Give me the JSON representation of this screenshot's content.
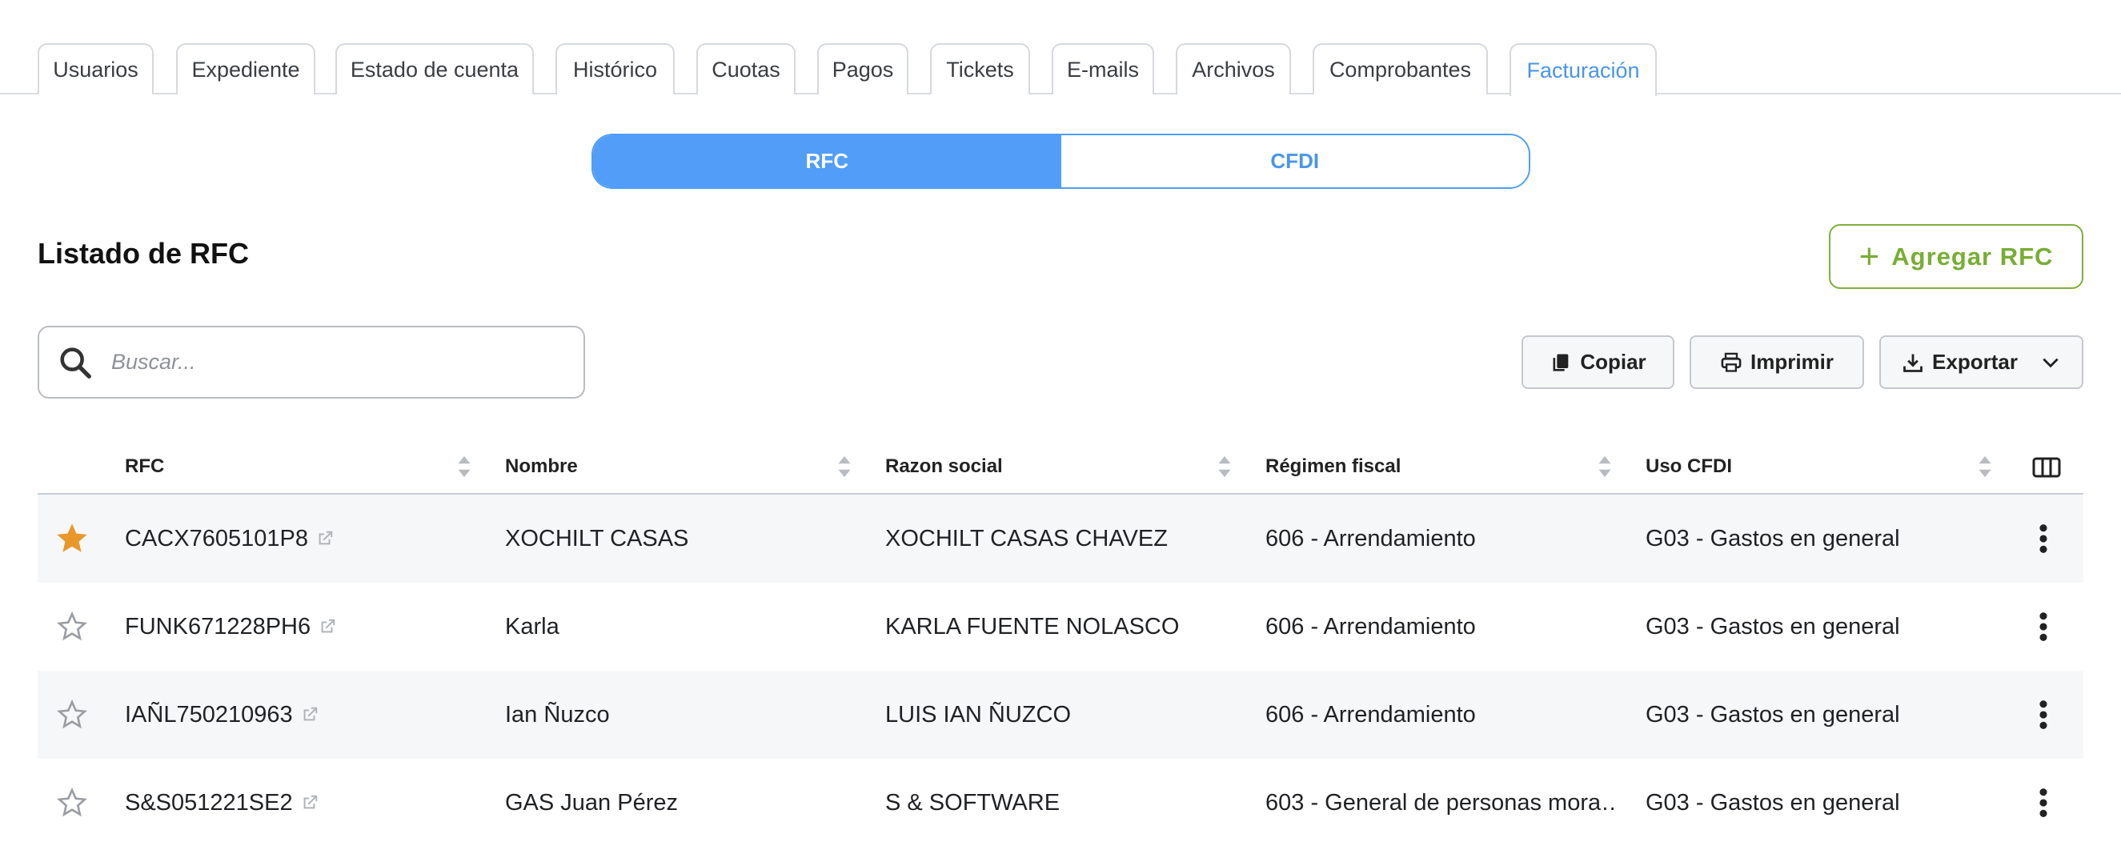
{
  "tabs": [
    {
      "label": "Usuarios",
      "active": false
    },
    {
      "label": "Expediente",
      "active": false
    },
    {
      "label": "Estado de cuenta",
      "active": false
    },
    {
      "label": "Histórico",
      "active": false
    },
    {
      "label": "Cuotas",
      "active": false
    },
    {
      "label": "Pagos",
      "active": false
    },
    {
      "label": "Tickets",
      "active": false
    },
    {
      "label": "E-mails",
      "active": false
    },
    {
      "label": "Archivos",
      "active": false
    },
    {
      "label": "Comprobantes",
      "active": false
    },
    {
      "label": "Facturación",
      "active": true
    }
  ],
  "segmented": {
    "options": [
      "RFC",
      "CFDI"
    ],
    "selected": "RFC"
  },
  "page_title": "Listado de RFC",
  "add_button": {
    "label": "Agregar RFC",
    "icon": "plus-icon"
  },
  "search": {
    "placeholder": "Buscar...",
    "value": "",
    "icon": "search-icon"
  },
  "toolbar": {
    "copy_label": "Copiar",
    "print_label": "Imprimir",
    "export_label": "Exportar"
  },
  "table": {
    "columns": [
      "RFC",
      "Nombre",
      "Razon social",
      "Régimen fiscal",
      "Uso CFDI"
    ],
    "rows": [
      {
        "favorite": true,
        "rfc": "CACX7605101P8",
        "nombre": "XOCHILT CASAS",
        "razon_social": "XOCHILT CASAS CHAVEZ",
        "regimen": "606 - Arrendamiento",
        "uso": "G03 - Gastos en general"
      },
      {
        "favorite": false,
        "rfc": "FUNK671228PH6",
        "nombre": "Karla",
        "razon_social": "KARLA FUENTE NOLASCO",
        "regimen": "606 - Arrendamiento",
        "uso": "G03  - Gastos en general"
      },
      {
        "favorite": false,
        "rfc": "IAÑL750210963",
        "nombre": "Ian Ñuzco",
        "razon_social": "LUIS IAN ÑUZCO",
        "regimen": "606 - Arrendamiento",
        "uso": "G03  - Gastos en general"
      },
      {
        "favorite": false,
        "rfc": "S&S051221SE2",
        "nombre": "GAS Juan Pérez",
        "razon_social": "S & SOFTWARE",
        "regimen": "603 - General de personas mora…",
        "uso": "G03  - Gastos en general"
      }
    ]
  },
  "colors": {
    "accent": "#529df7",
    "add": "#78ad34",
    "star_on": "#e8982a"
  }
}
